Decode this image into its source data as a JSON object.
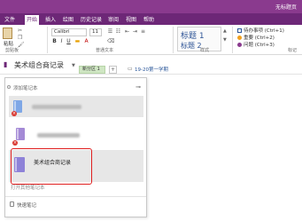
{
  "window": {
    "doc_title": "无标题页"
  },
  "menu": {
    "items": [
      "文件",
      "开始",
      "插入",
      "绘图",
      "历史记录",
      "审阅",
      "视图",
      "帮助"
    ],
    "active": "开始"
  },
  "ribbon": {
    "paste_label": "粘贴",
    "clipboard_label": "剪贴板",
    "font_name": "Calibri",
    "font_size": "11",
    "basic_text_label": "普通文本",
    "styles": {
      "heading1": "标题 1",
      "heading2": "标题 2",
      "label": "样式"
    },
    "tags": [
      {
        "label": "待办事项 (Ctrl+1)",
        "color": "#2b579a"
      },
      {
        "label": "重要 (Ctrl+2)",
        "color": "#f0a020"
      },
      {
        "label": "问题 (Ctrl+3)",
        "color": "#8a3a8e"
      }
    ],
    "tags_label": "标记"
  },
  "notebook_bar": {
    "notebook_title": "美术组合商记录",
    "section_tab": "新分区 1",
    "add_tab": "+",
    "page_link": "19-20第一学期"
  },
  "dropdown": {
    "add_notebook": "添加笔记本",
    "notebooks": [
      {
        "name": "",
        "color": "#7fa7e6",
        "error": true
      },
      {
        "name": "",
        "color": "#a48ad6",
        "error": true
      },
      {
        "name": "美术组合商记录",
        "color": "#8e82d8",
        "error": false
      }
    ],
    "open_other": "打开其他笔记本",
    "quick_notes": "快速笔记"
  },
  "colors": {
    "title_bar": "#8a3a8e",
    "menu_bar": "#6d2777",
    "highlight": "#e02020",
    "section_tab": "#cfe6c3"
  }
}
